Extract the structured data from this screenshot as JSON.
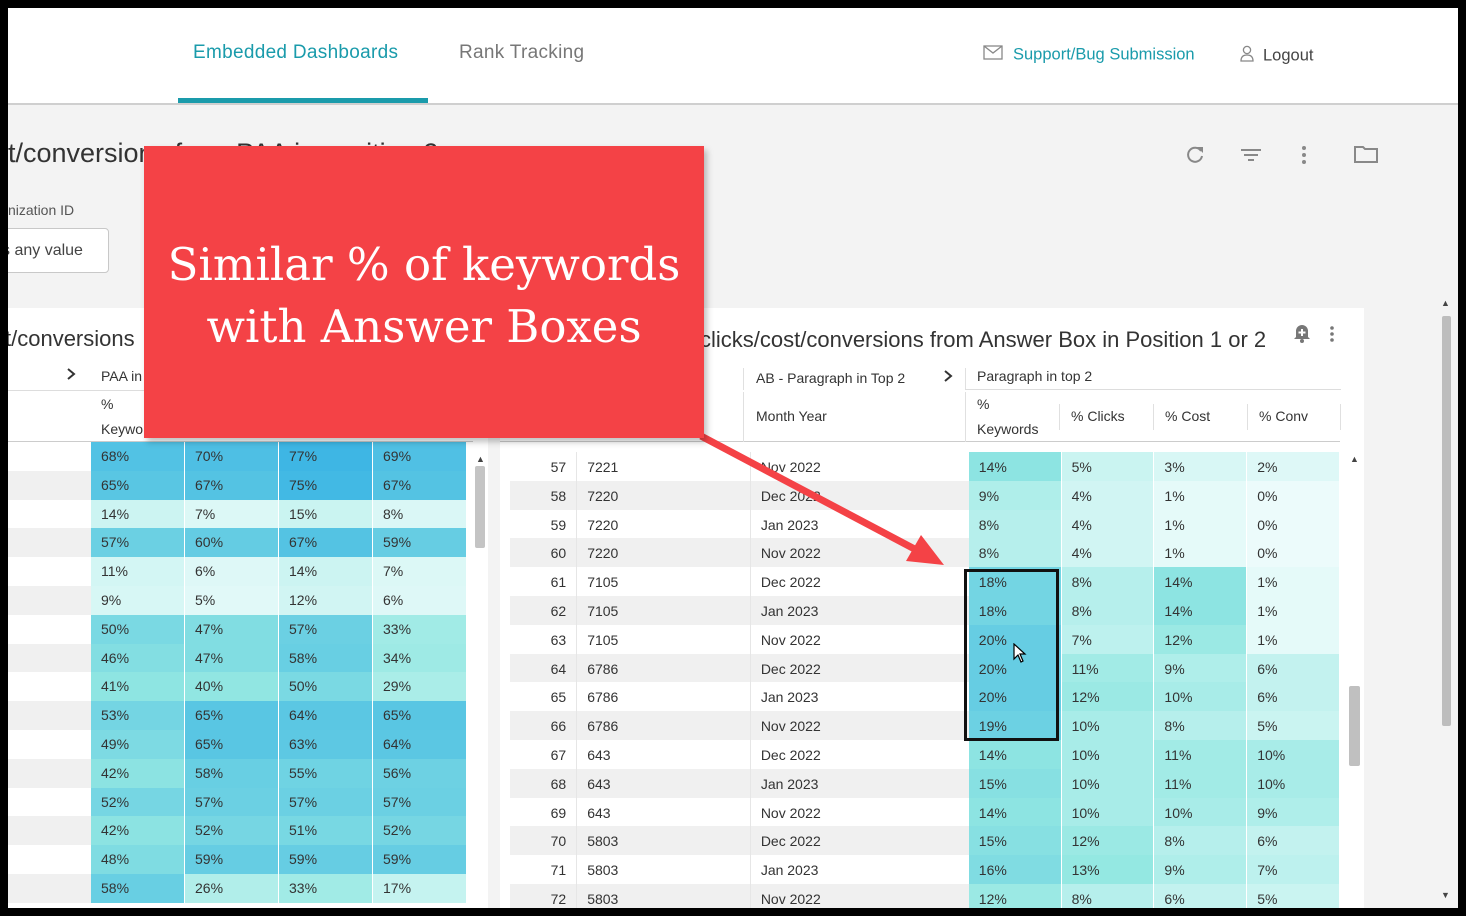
{
  "nav": {
    "tab_embedded": "Embedded Dashboards",
    "tab_rank": "Rank Tracking",
    "support": "Support/Bug Submission",
    "logout": "Logout",
    "accent": "#1a9bab"
  },
  "dashboard": {
    "title": "t/conversions from PAA in position 2",
    "filter_label": "nization ID",
    "filter_value": "s any value",
    "icons": [
      "refresh-icon",
      "filter-icon",
      "more-vert-icon",
      "folder-icon"
    ]
  },
  "left_tile": {
    "title": "t/conversions",
    "pivot_header": "PAA in",
    "col_header_line1": "%",
    "col_header_line2": "Keywo",
    "rows": [
      [
        "68%",
        "70%",
        "77%",
        "69%"
      ],
      [
        "65%",
        "67%",
        "75%",
        "67%"
      ],
      [
        "14%",
        "7%",
        "15%",
        "8%"
      ],
      [
        "57%",
        "60%",
        "67%",
        "59%"
      ],
      [
        "11%",
        "6%",
        "14%",
        "7%"
      ],
      [
        "9%",
        "5%",
        "12%",
        "6%"
      ],
      [
        "50%",
        "47%",
        "57%",
        "33%"
      ],
      [
        "46%",
        "47%",
        "58%",
        "34%"
      ],
      [
        "41%",
        "40%",
        "50%",
        "29%"
      ],
      [
        "53%",
        "65%",
        "64%",
        "65%"
      ],
      [
        "49%",
        "65%",
        "63%",
        "64%"
      ],
      [
        "42%",
        "58%",
        "55%",
        "56%"
      ],
      [
        "52%",
        "57%",
        "57%",
        "57%"
      ],
      [
        "42%",
        "52%",
        "51%",
        "52%"
      ],
      [
        "48%",
        "59%",
        "59%",
        "59%"
      ],
      [
        "58%",
        "26%",
        "33%",
        "17%"
      ]
    ]
  },
  "right_tile": {
    "title": "clicks/cost/conversions from Answer Box in Position 1 or 2",
    "pivot_ab": "AB - Paragraph in Top 2",
    "pivot_para": "Paragraph in top 2",
    "col_month": "Month Year",
    "col_kw_1": "%",
    "col_kw_2": "Keywords",
    "col_clicks": "% Clicks",
    "col_cost": "% Cost",
    "col_conv": "% Conv",
    "rows": [
      {
        "n": "57",
        "id": "7221",
        "month": "Nov 2022",
        "kw": "14%",
        "clicks": "5%",
        "cost": "3%",
        "conv": "2%"
      },
      {
        "n": "58",
        "id": "7220",
        "month": "Dec 2022",
        "kw": "9%",
        "clicks": "4%",
        "cost": "1%",
        "conv": "0%"
      },
      {
        "n": "59",
        "id": "7220",
        "month": "Jan 2023",
        "kw": "8%",
        "clicks": "4%",
        "cost": "1%",
        "conv": "0%"
      },
      {
        "n": "60",
        "id": "7220",
        "month": "Nov 2022",
        "kw": "8%",
        "clicks": "4%",
        "cost": "1%",
        "conv": "0%"
      },
      {
        "n": "61",
        "id": "7105",
        "month": "Dec 2022",
        "kw": "18%",
        "clicks": "8%",
        "cost": "14%",
        "conv": "1%"
      },
      {
        "n": "62",
        "id": "7105",
        "month": "Jan 2023",
        "kw": "18%",
        "clicks": "8%",
        "cost": "14%",
        "conv": "1%"
      },
      {
        "n": "63",
        "id": "7105",
        "month": "Nov 2022",
        "kw": "20%",
        "clicks": "7%",
        "cost": "12%",
        "conv": "1%"
      },
      {
        "n": "64",
        "id": "6786",
        "month": "Dec 2022",
        "kw": "20%",
        "clicks": "11%",
        "cost": "9%",
        "conv": "6%"
      },
      {
        "n": "65",
        "id": "6786",
        "month": "Jan 2023",
        "kw": "20%",
        "clicks": "12%",
        "cost": "10%",
        "conv": "6%"
      },
      {
        "n": "66",
        "id": "6786",
        "month": "Nov 2022",
        "kw": "19%",
        "clicks": "10%",
        "cost": "8%",
        "conv": "5%"
      },
      {
        "n": "67",
        "id": "643",
        "month": "Dec 2022",
        "kw": "14%",
        "clicks": "10%",
        "cost": "11%",
        "conv": "10%"
      },
      {
        "n": "68",
        "id": "643",
        "month": "Jan 2023",
        "kw": "15%",
        "clicks": "10%",
        "cost": "11%",
        "conv": "10%"
      },
      {
        "n": "69",
        "id": "643",
        "month": "Nov 2022",
        "kw": "14%",
        "clicks": "10%",
        "cost": "10%",
        "conv": "9%"
      },
      {
        "n": "70",
        "id": "5803",
        "month": "Dec 2022",
        "kw": "15%",
        "clicks": "12%",
        "cost": "8%",
        "conv": "6%"
      },
      {
        "n": "71",
        "id": "5803",
        "month": "Jan 2023",
        "kw": "16%",
        "clicks": "13%",
        "cost": "9%",
        "conv": "7%"
      },
      {
        "n": "72",
        "id": "5803",
        "month": "Nov 2022",
        "kw": "12%",
        "clicks": "8%",
        "cost": "6%",
        "conv": "5%"
      }
    ]
  },
  "callout": {
    "text": "Similar % of keywords\nwith Answer Boxes",
    "color": "#f44246"
  }
}
